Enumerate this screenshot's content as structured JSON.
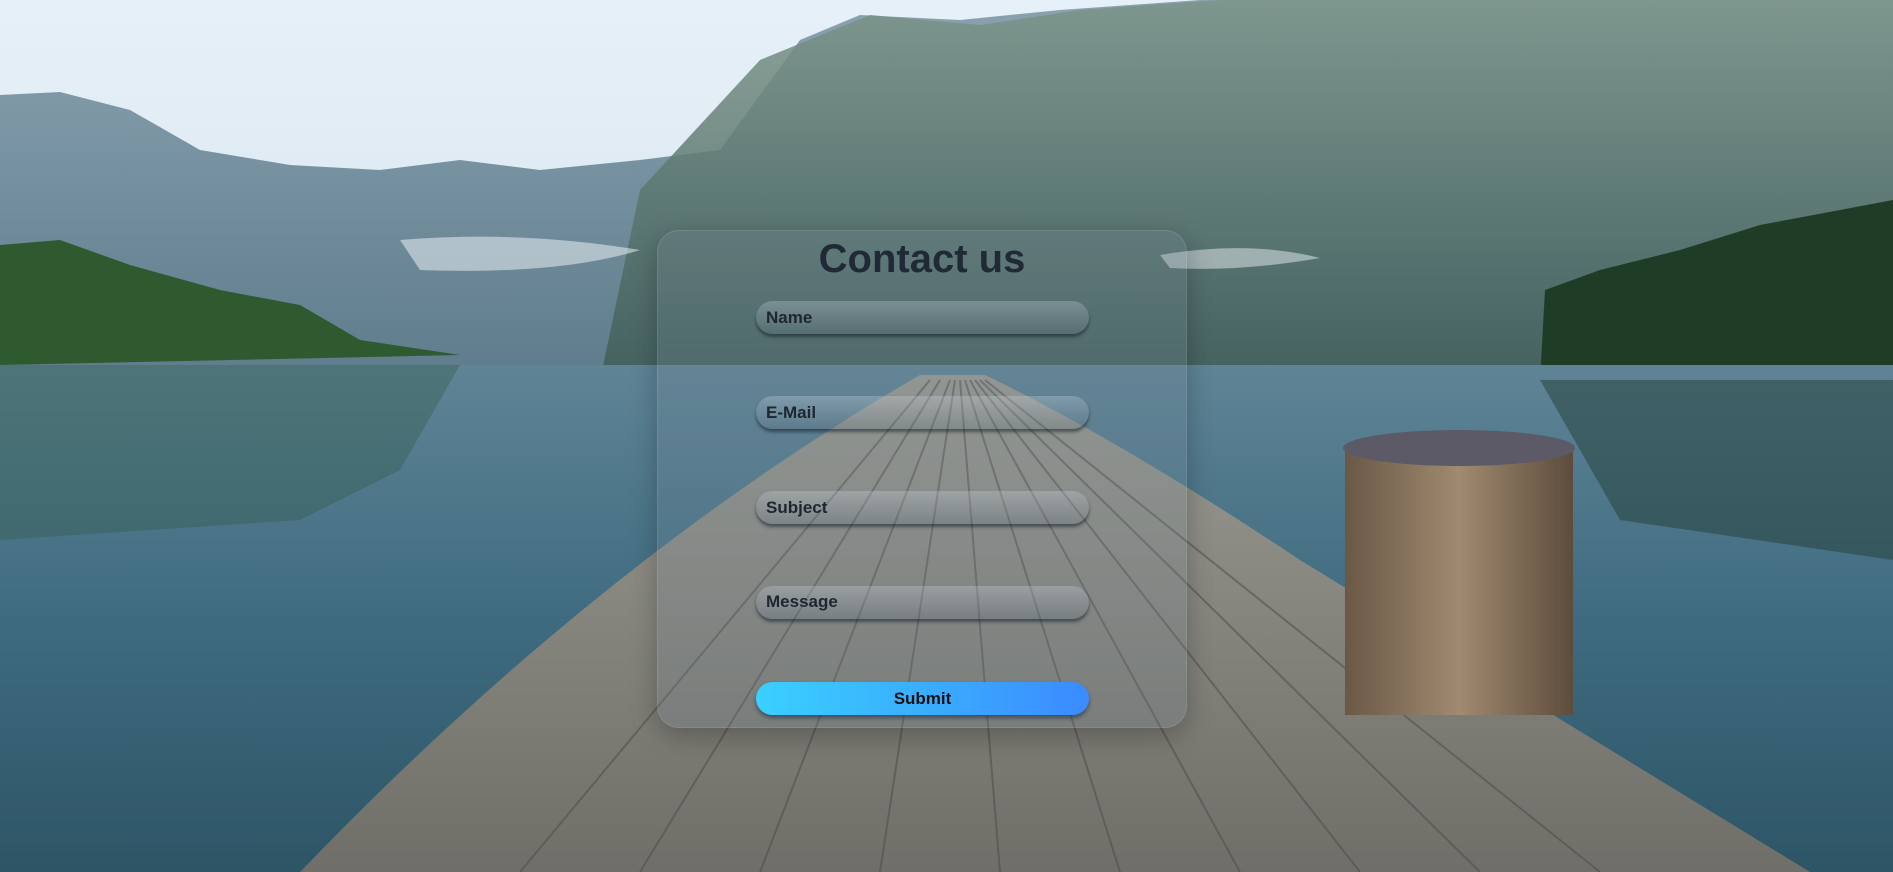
{
  "page": {
    "background": "lake-pier-mountains-photo"
  },
  "form": {
    "title": "Contact us",
    "fields": {
      "name": {
        "placeholder": "Name"
      },
      "email": {
        "placeholder": "E-Mail"
      },
      "subject": {
        "placeholder": "Subject"
      },
      "message": {
        "placeholder": "Message"
      }
    },
    "submit_label": "Submit",
    "colors": {
      "submit_gradient_start": "#3ad0ff",
      "submit_gradient_end": "#3b8bff",
      "title": "#1f2a36"
    }
  }
}
